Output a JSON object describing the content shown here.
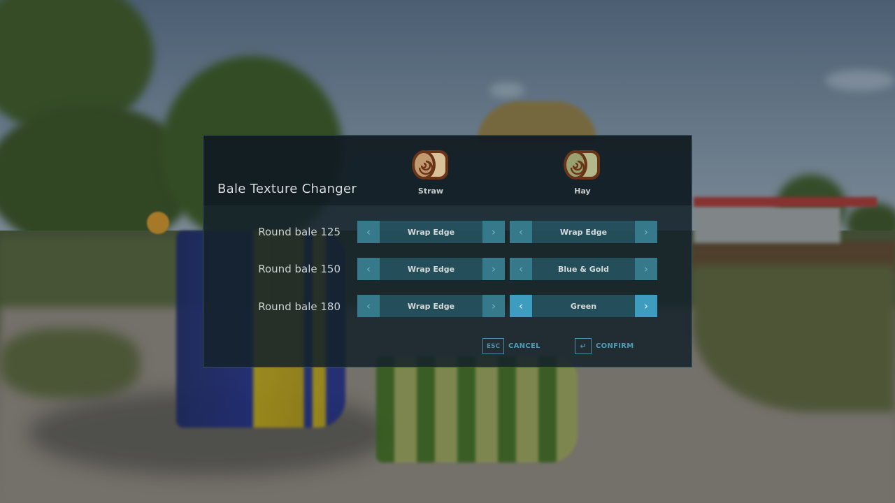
{
  "dialog": {
    "title": "Bale Texture Changer",
    "columns": [
      {
        "key": "straw",
        "label": "Straw",
        "icon": "straw-bale-icon",
        "fill_color": "#d9c19a",
        "outline_color": "#6a3418"
      },
      {
        "key": "hay",
        "label": "Hay",
        "icon": "hay-bale-icon",
        "fill_color": "#b4b98c",
        "outline_color": "#6a3418"
      }
    ],
    "rows": [
      {
        "label": "Round bale 125",
        "straw": "Wrap Edge",
        "hay": "Wrap Edge"
      },
      {
        "label": "Round bale 150",
        "straw": "Wrap Edge",
        "hay": "Blue & Gold"
      },
      {
        "label": "Round bale 180",
        "straw": "Wrap Edge",
        "hay": "Green"
      }
    ],
    "arrows": {
      "left": "‹",
      "right": "›"
    },
    "active_selector": {
      "row": 2,
      "column": "hay"
    },
    "buttons": {
      "cancel": {
        "key": "ESC",
        "label": "CANCEL"
      },
      "confirm": {
        "key": "↵",
        "label": "CONFIRM"
      }
    }
  },
  "colors": {
    "accent": "#3e9cbe",
    "selector_bg": "#306878",
    "footer_text": "#4f9ab3"
  }
}
